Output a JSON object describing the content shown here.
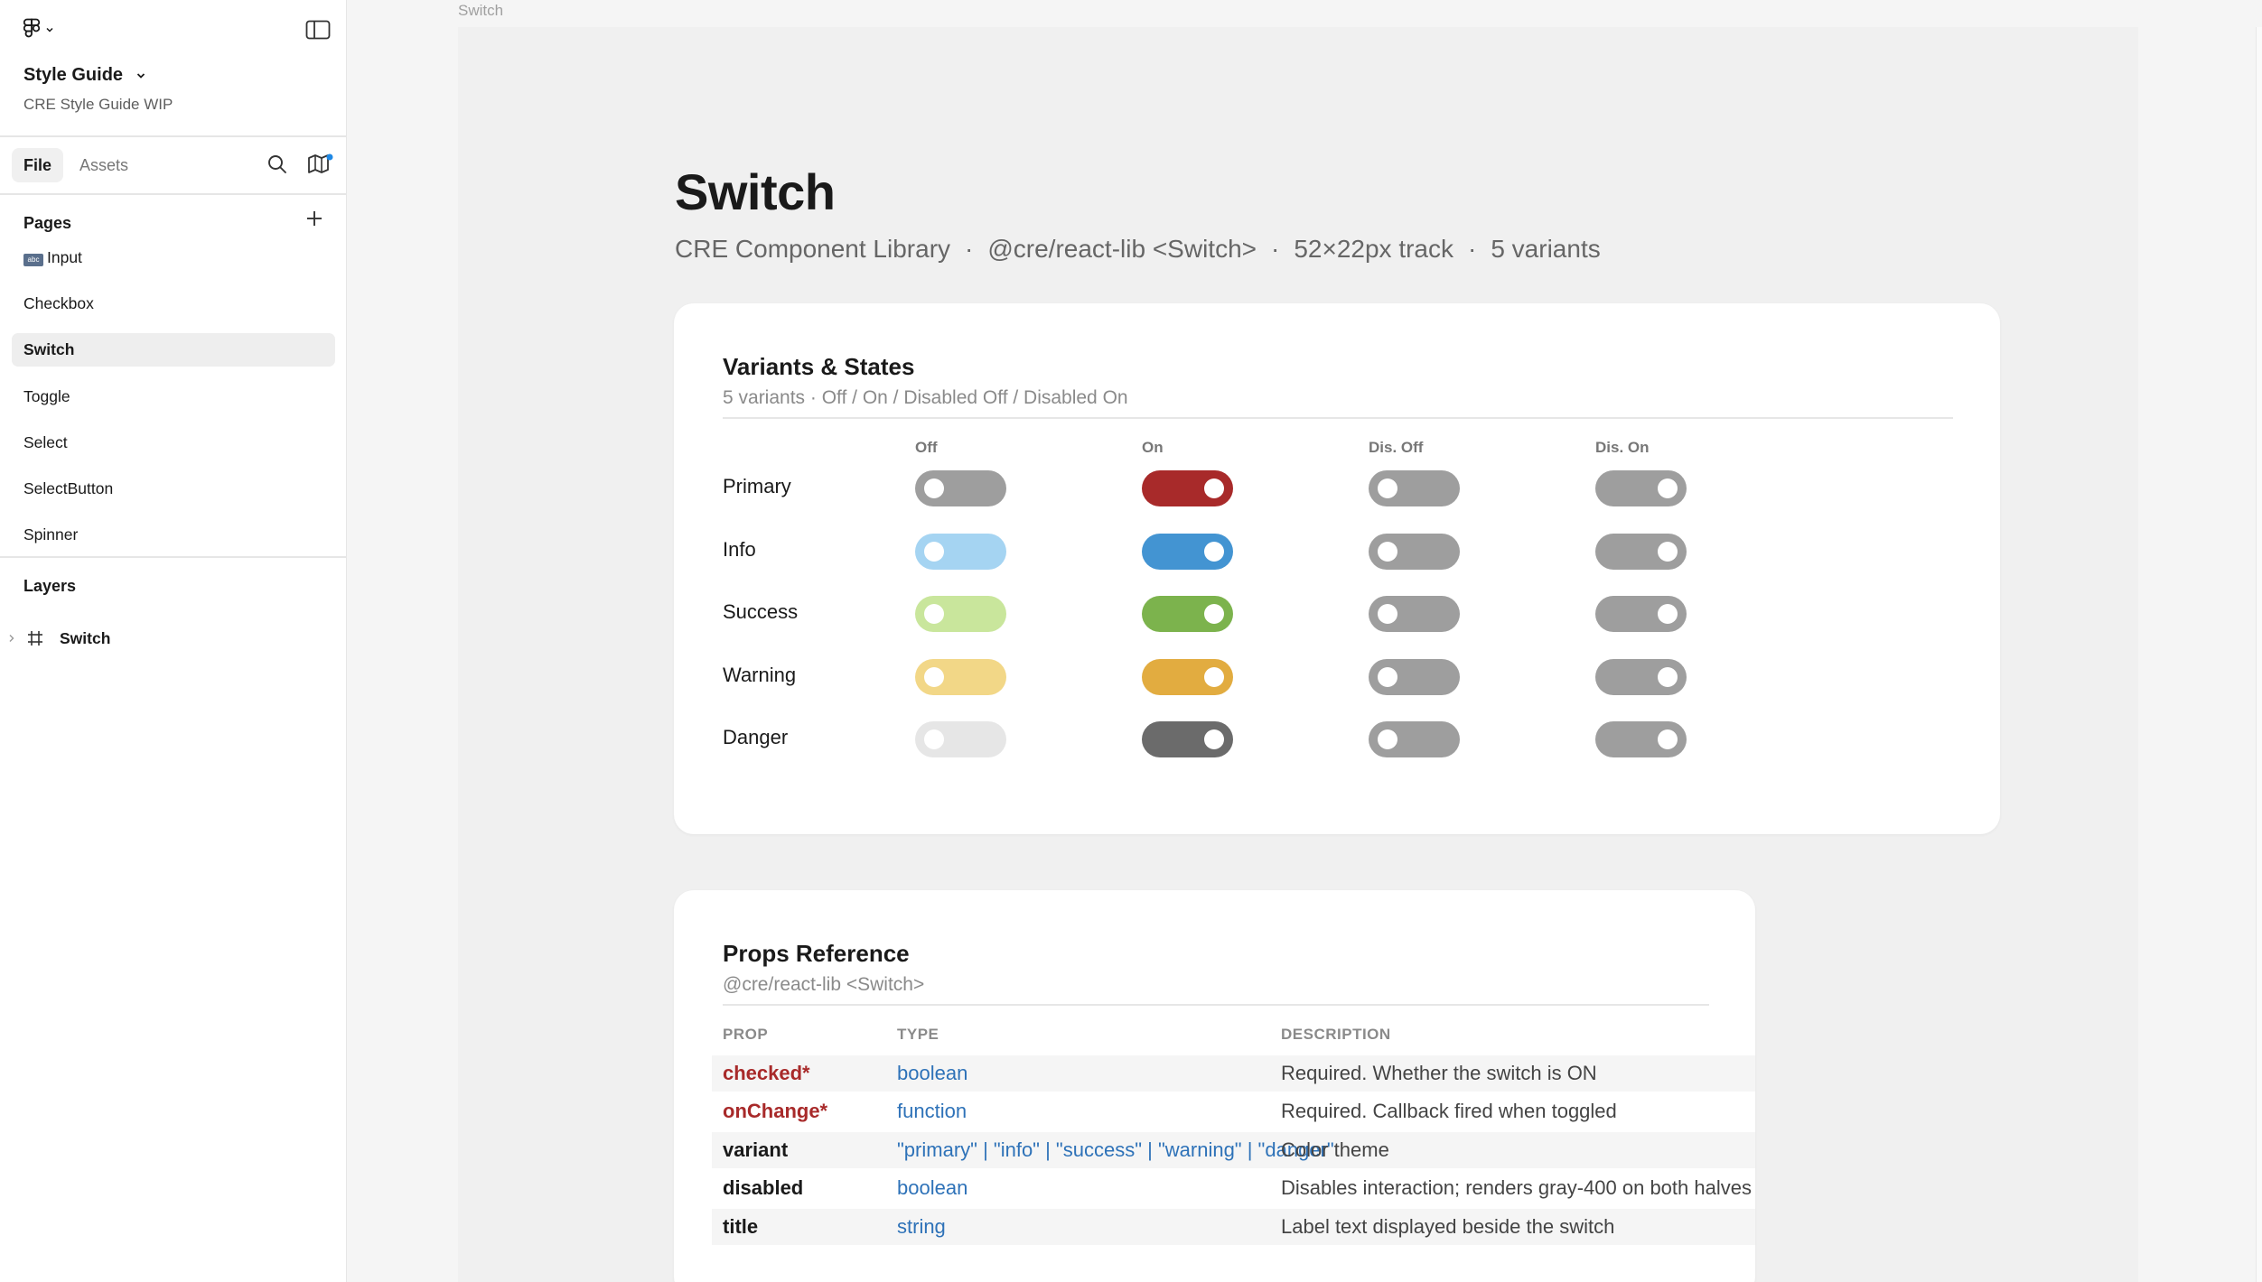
{
  "sidebar": {
    "file_title": "Style Guide",
    "file_subtitle": "CRE Style Guide WIP",
    "tabs": {
      "file": "File",
      "assets": "Assets"
    },
    "pages_label": "Pages",
    "pages": [
      {
        "label": "Input",
        "badge": "abc"
      },
      {
        "label": "Checkbox"
      },
      {
        "label": "Switch"
      },
      {
        "label": "Toggle"
      },
      {
        "label": "Select"
      },
      {
        "label": "SelectButton"
      },
      {
        "label": "Spinner"
      }
    ],
    "layers_label": "Layers",
    "layers": [
      {
        "label": "Switch"
      }
    ]
  },
  "canvas": {
    "frame_label": "Switch",
    "title": "Switch",
    "meta": [
      "CRE Component Library",
      "@cre/react-lib <Switch>",
      "52×22px track",
      "5 variants"
    ],
    "variants_card": {
      "title": "Variants & States",
      "subtitle": "5 variants · Off / On / Disabled Off / Disabled On",
      "columns": [
        "Off",
        "On",
        "Dis. Off",
        "Dis. On"
      ],
      "rows": [
        {
          "label": "Primary",
          "off": "#9e9e9e",
          "on": "#a82a2a"
        },
        {
          "label": "Info",
          "off": "#a5d4f2",
          "on": "#4394d2"
        },
        {
          "label": "Success",
          "off": "#c9e69c",
          "on": "#7cb34d"
        },
        {
          "label": "Warning",
          "off": "#f2d787",
          "on": "#e2ac40"
        },
        {
          "label": "Danger",
          "off": "#e6e6e6",
          "on": "#6b6b6b"
        }
      ],
      "disabled_color": "#9e9e9e"
    },
    "props_card": {
      "title": "Props Reference",
      "subtitle": "@cre/react-lib <Switch>",
      "headers": [
        "PROP",
        "TYPE",
        "DESCRIPTION"
      ],
      "rows": [
        {
          "prop": "checked*",
          "required": true,
          "type": "boolean",
          "description": "Required. Whether the switch is ON"
        },
        {
          "prop": "onChange*",
          "required": true,
          "type": "function",
          "description": "Required. Callback fired when toggled"
        },
        {
          "prop": "variant",
          "required": false,
          "type": "\"primary\" | \"info\" | \"success\" | \"warning\" | \"danger\"",
          "description": "Color theme"
        },
        {
          "prop": "disabled",
          "required": false,
          "type": "boolean",
          "description": "Disables interaction; renders gray-400 on both halves"
        },
        {
          "prop": "title",
          "required": false,
          "type": "string",
          "description": "Label text displayed beside the switch"
        }
      ]
    }
  }
}
